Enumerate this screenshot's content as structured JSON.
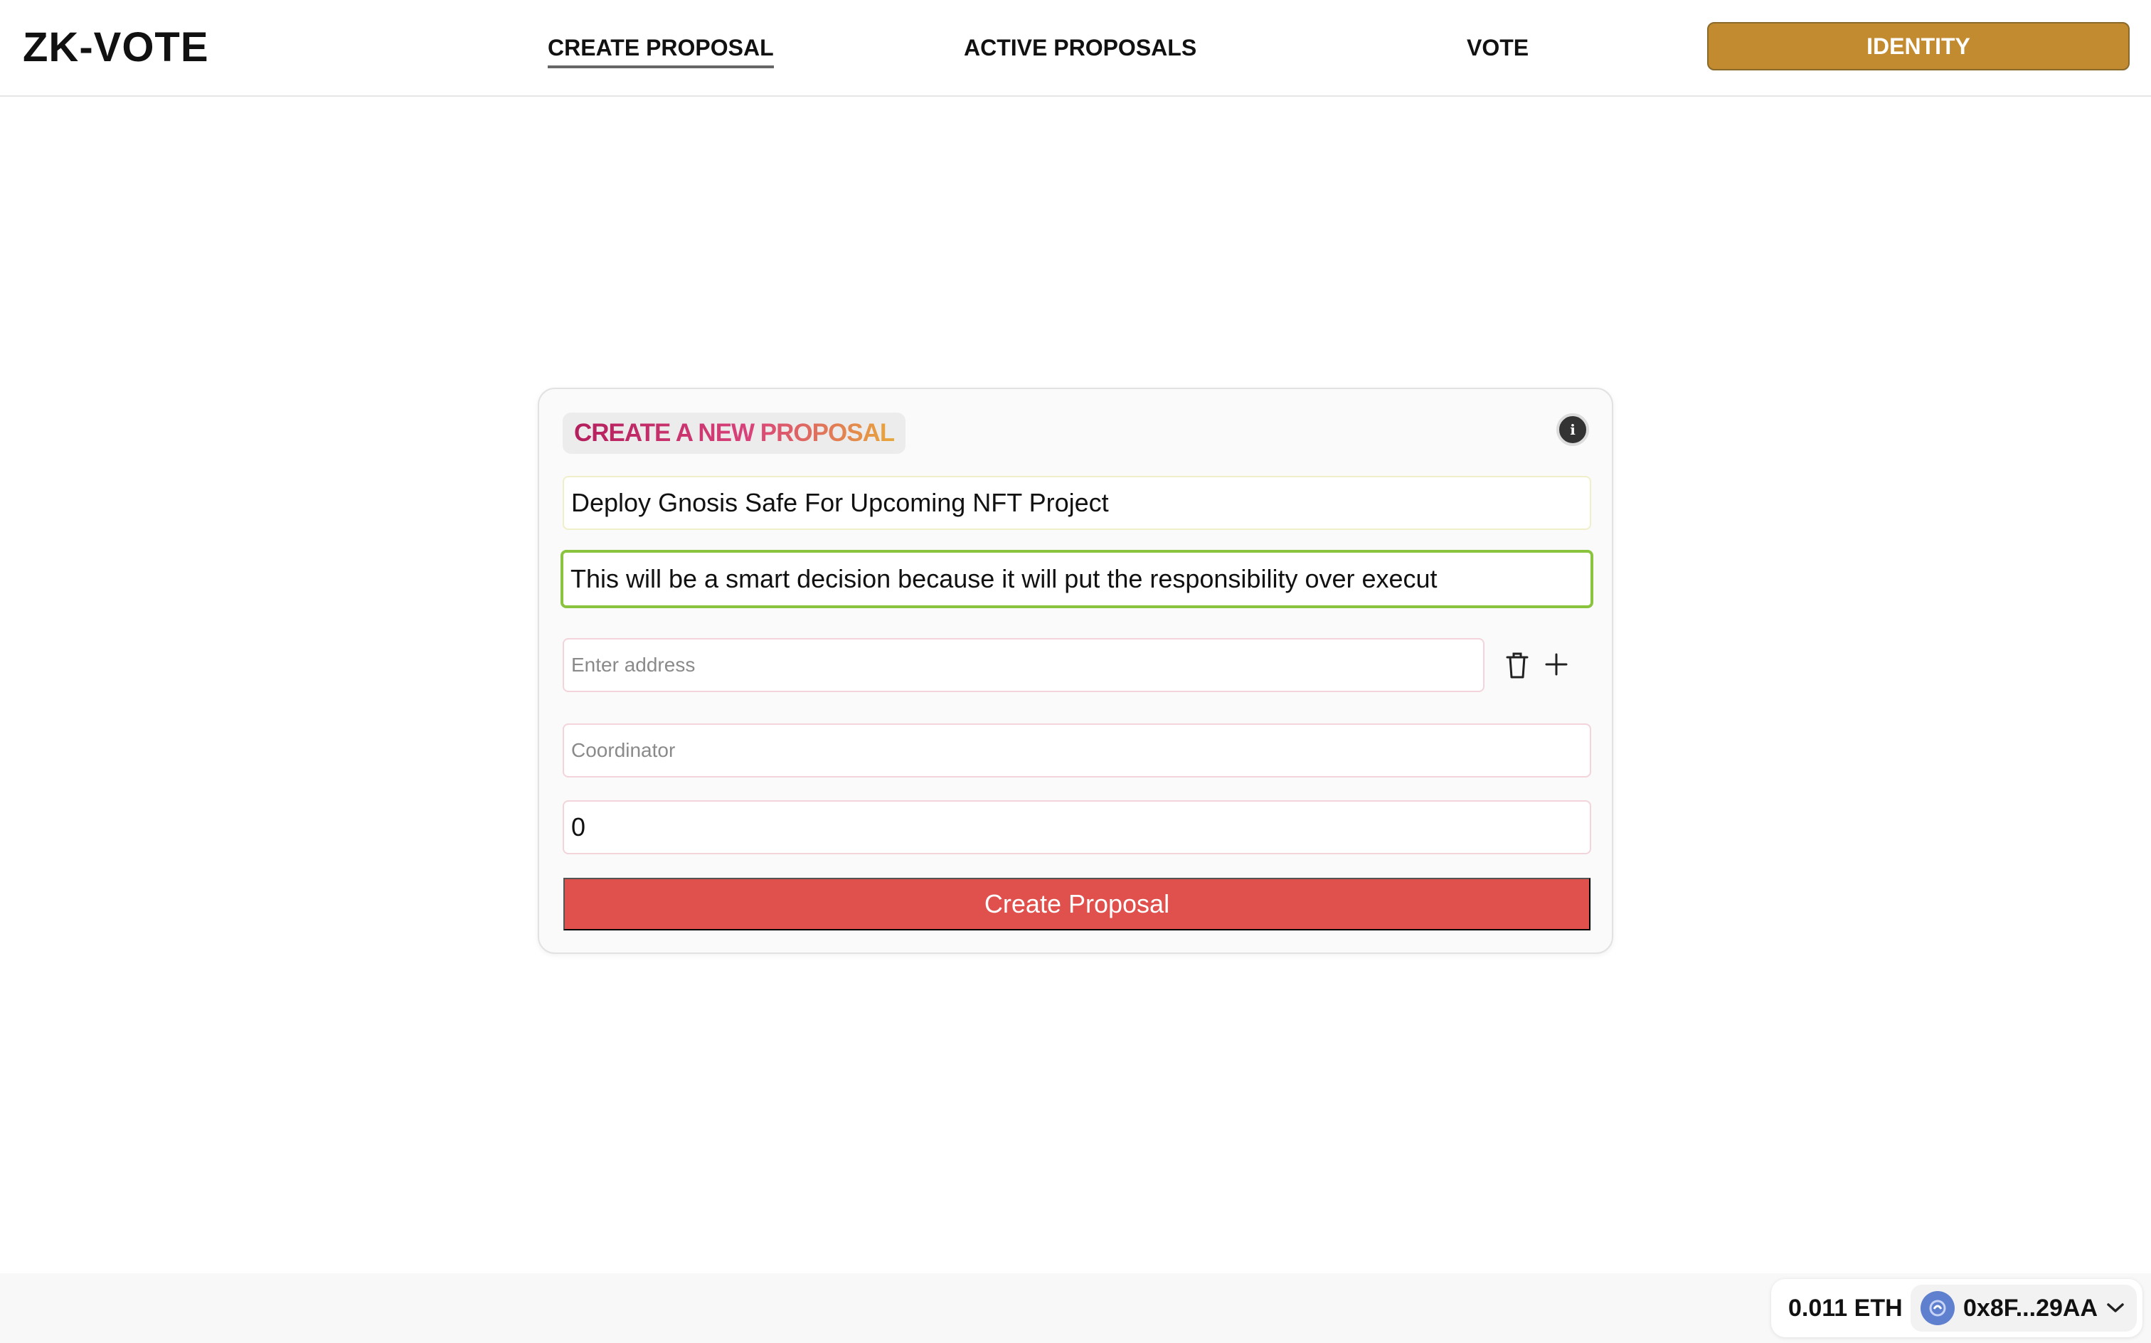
{
  "header": {
    "logo": "ZK-VOTE",
    "nav": {
      "create": "CREATE PROPOSAL",
      "active": "ACTIVE PROPOSALS",
      "vote": "VOTE"
    },
    "identity_label": "IDENTITY",
    "identity_color": "#c28b2f"
  },
  "form": {
    "title": "CREATE A NEW PROPOSAL",
    "proposal_title_value": "Deploy Gnosis Safe For Upcoming NFT Project",
    "description_value": "This will be a smart decision because it will put the responsibility over execut",
    "address_placeholder": "Enter address",
    "coordinator_placeholder": "Coordinator",
    "number_value": "0",
    "submit_label": "Create Proposal",
    "submit_color": "#e0504d",
    "icons": [
      "info-icon",
      "trash-icon",
      "plus-icon"
    ]
  },
  "wallet": {
    "balance": "0.011 ETH",
    "address": "0x8F...29AA",
    "icons": [
      "avatar-icon",
      "chevron-down-icon"
    ]
  }
}
